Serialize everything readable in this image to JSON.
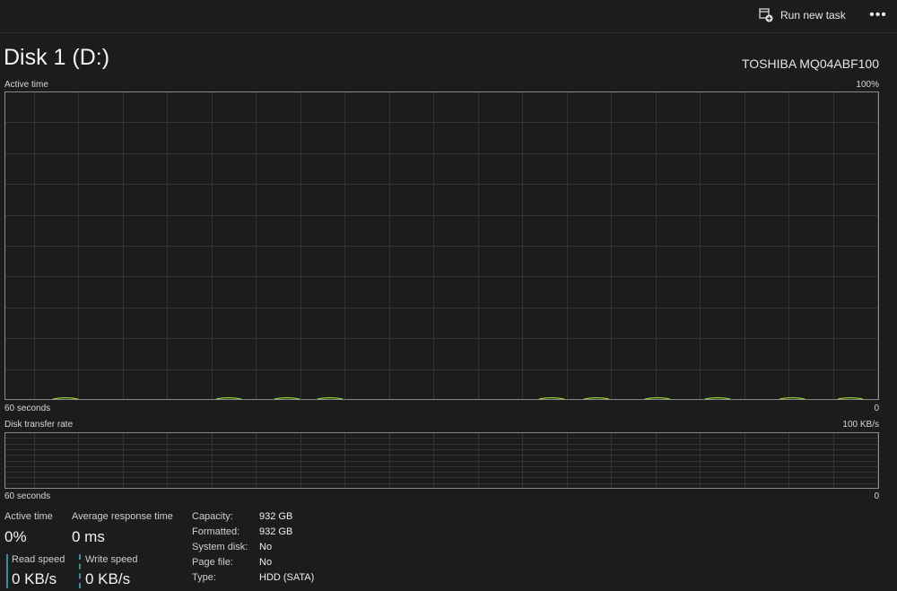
{
  "toolbar": {
    "run_new_task": "Run new task",
    "run_icon": "run-task-icon",
    "more_icon": "ellipsis-icon"
  },
  "header": {
    "title": "Disk 1 (D:)",
    "model": "TOSHIBA MQ04ABF100"
  },
  "active_graph": {
    "label": "Active time",
    "max_label": "100%",
    "time_label": "60 seconds",
    "min_label": "0",
    "color": "#9acd32"
  },
  "transfer_graph": {
    "label": "Disk transfer rate",
    "max_label": "100 KB/s",
    "time_label": "60 seconds",
    "min_label": "0"
  },
  "stats": {
    "active_time_label": "Active time",
    "active_time_value": "0%",
    "avg_response_label": "Average response time",
    "avg_response_value": "0 ms",
    "read_speed_label": "Read speed",
    "read_speed_value": "0 KB/s",
    "write_speed_label": "Write speed",
    "write_speed_value": "0 KB/s"
  },
  "properties": [
    {
      "label": "Capacity:",
      "value": "932 GB"
    },
    {
      "label": "Formatted:",
      "value": "932 GB"
    },
    {
      "label": "System disk:",
      "value": "No"
    },
    {
      "label": "Page file:",
      "value": "No"
    },
    {
      "label": "Type:",
      "value": "HDD (SATA)"
    }
  ],
  "colors": {
    "background": "#1c1c1c",
    "grid": "#343434",
    "border": "#8a8a8a",
    "accent": "#3b8f95"
  }
}
